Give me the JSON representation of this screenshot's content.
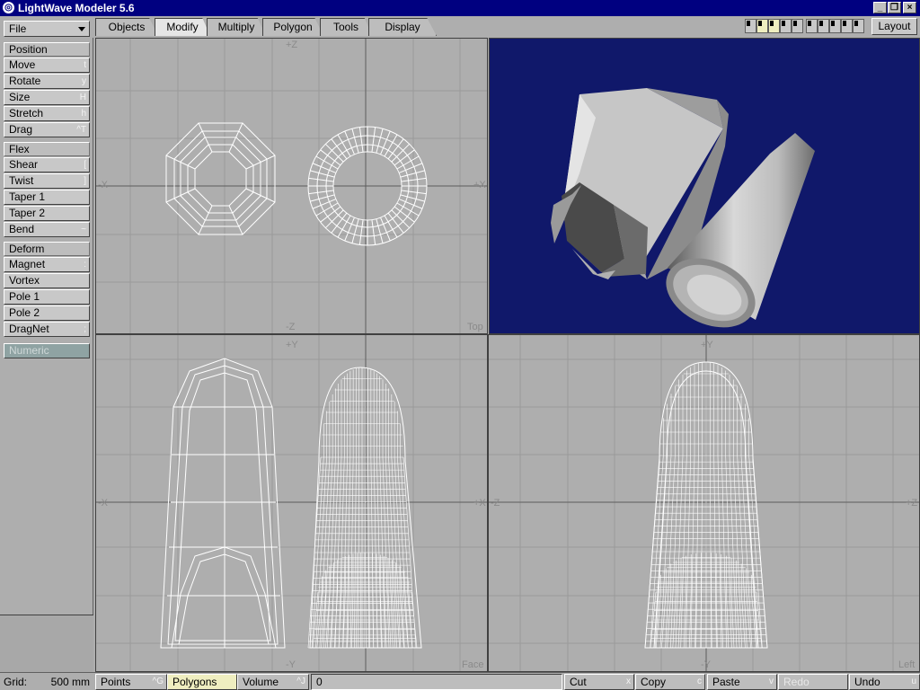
{
  "window": {
    "title": "LightWave Modeler 5.6"
  },
  "file_menu": {
    "label": "File"
  },
  "tabs": [
    {
      "label": "Objects",
      "active": false
    },
    {
      "label": "Modify",
      "active": true
    },
    {
      "label": "Multiply",
      "active": false
    },
    {
      "label": "Polygon",
      "active": false
    },
    {
      "label": "Tools",
      "active": false
    },
    {
      "label": "Display",
      "active": false
    }
  ],
  "layout_button": "Layout",
  "sidebar": {
    "position": {
      "header": "Position",
      "tools": [
        {
          "label": "Move",
          "key": "t"
        },
        {
          "label": "Rotate",
          "key": "y"
        },
        {
          "label": "Size",
          "key": "H"
        },
        {
          "label": "Stretch",
          "key": "h"
        },
        {
          "label": "Drag",
          "key": "^T"
        }
      ]
    },
    "flex": {
      "header": "Flex",
      "tools": [
        {
          "label": "Shear",
          "key": "["
        },
        {
          "label": "Twist",
          "key": "]"
        },
        {
          "label": "Taper 1",
          "key": ""
        },
        {
          "label": "Taper 2",
          "key": ""
        },
        {
          "label": "Bend",
          "key": "~"
        }
      ]
    },
    "deform": {
      "header": "Deform",
      "tools": [
        {
          "label": "Magnet",
          "key": ":"
        },
        {
          "label": "Vortex",
          "key": ""
        },
        {
          "label": "Pole 1",
          "key": ""
        },
        {
          "label": "Pole 2",
          "key": ""
        },
        {
          "label": "DragNet",
          "key": ";"
        }
      ]
    },
    "numeric": "Numeric"
  },
  "viewports": {
    "top": {
      "name": "Top",
      "axis_up": "+Z",
      "axis_down": "-Z",
      "axis_left": "-X",
      "axis_right": "+X"
    },
    "face": {
      "name": "Face",
      "axis_up": "+Y",
      "axis_down": "-Y",
      "axis_left": "-X",
      "axis_right": "+X"
    },
    "side": {
      "name": "Left",
      "axis_up": "+Y",
      "axis_down": "-Y",
      "axis_left": "-Z",
      "axis_right": "+Z"
    }
  },
  "statusbar": {
    "grid_label": "Grid:",
    "grid_value": "500 mm",
    "points": {
      "label": "Points",
      "key": "^G"
    },
    "polygons": {
      "label": "Polygons",
      "key": ""
    },
    "volume": {
      "label": "Volume",
      "key": "^J"
    },
    "selection_count": "0",
    "cut": {
      "label": "Cut",
      "key": "x"
    },
    "copy": {
      "label": "Copy",
      "key": "c"
    },
    "paste": {
      "label": "Paste",
      "key": "v"
    },
    "redo": {
      "label": "Redo",
      "key": ""
    },
    "undo": {
      "label": "Undo",
      "key": "u"
    }
  },
  "colors": {
    "title_bar": "#000080",
    "camera_bg": "#10186a",
    "selected": "#efeec0",
    "viewport_bg": "#aeaeae"
  }
}
